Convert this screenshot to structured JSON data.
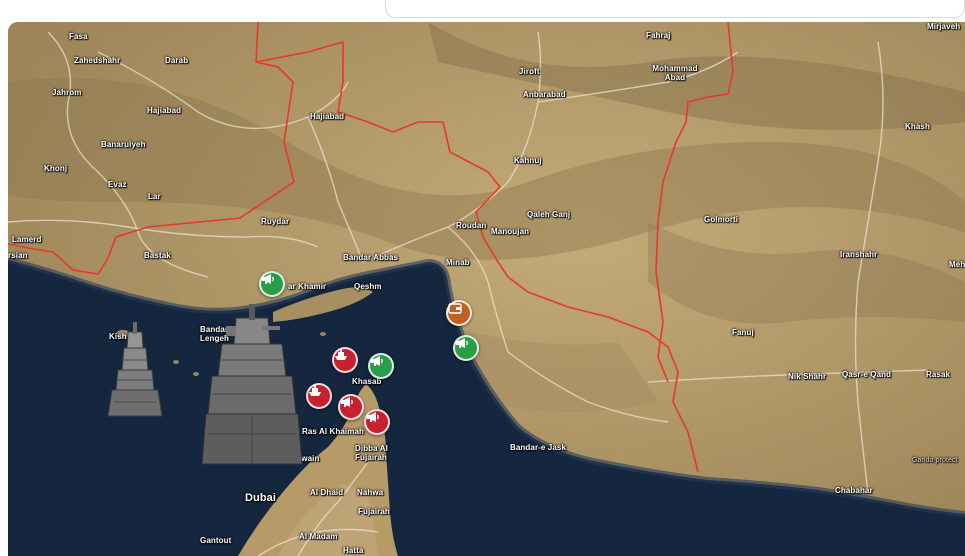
{
  "map": {
    "places": {
      "fasa": "Fasa",
      "zahedshahr": "Zahedshahr",
      "darab": "Darab",
      "jahrom": "Jahrom",
      "hajiabad_w": "Hajiabad",
      "banaruiyeh": "Banaruiyeh",
      "khonj": "Khonj",
      "evaz": "Evaz",
      "lar": "Lar",
      "lamerd": "Lamerd",
      "siran": "rsian",
      "bastak": "Bastak",
      "ruydar": "Ruydar",
      "hajiabad": "Hajiabad",
      "bandar_khamir": "ar Khamir",
      "bandar_lengeh": "Bandar-e Lengeh",
      "kish": "Kish",
      "qeshm": "Qeshm",
      "bandar_abbas": "Bandar Abbas",
      "minab": "Minab",
      "roudan": "Roudan",
      "manoujan": "Manoujan",
      "qaleh_ganj": "Qaleh Ganj",
      "kahnuj": "Kahnuj",
      "anbarabad": "Anbarabad",
      "jiroft": "Jiroft",
      "fahraj": "Fahraj",
      "mohammad_abad": "Mohammad Abad",
      "mirjaveh": "Mirjaveh",
      "khash": "Khash",
      "golmorti": "Golmorti",
      "iranshahr": "Iranshahr",
      "mehr": "Meh",
      "fanuj": "Fanuj",
      "nik_shahr": "Nik Shahr",
      "qasr_e_qand": "Qasr-e Qand",
      "rasak": "Rasak",
      "chabahar": "Chabahar",
      "bandar_e_jask": "Bandar-e Jask",
      "khasab": "Khasab",
      "ras_al_khaimah": "Ras Al Khaimah",
      "quwain": "Quwain",
      "dibba": "Dibba Al Fujairah",
      "dubai": "Dubai",
      "al_dhaid": "Al Dhaid",
      "nahwa": "Nahwa",
      "fujairah": "Fujairah",
      "gantout": "Gantout",
      "al_madam": "Al Madam",
      "hatta": "Hatta",
      "gando": "Gando protect"
    },
    "markers": [
      {
        "name": "megaphone-marker-green-khamir",
        "color": "#2a9d48",
        "icon": "megaphone-icon"
      },
      {
        "name": "ship-marker-red-1",
        "color": "#c9202f",
        "icon": "ship-icon"
      },
      {
        "name": "megaphone-marker-green-khasab",
        "color": "#2a9d48",
        "icon": "megaphone-icon"
      },
      {
        "name": "ship-marker-red-2",
        "color": "#c9202f",
        "icon": "ship-icon"
      },
      {
        "name": "megaphone-marker-red-1",
        "color": "#c9202f",
        "icon": "megaphone-icon"
      },
      {
        "name": "megaphone-marker-red-2",
        "color": "#c9202f",
        "icon": "megaphone-icon"
      },
      {
        "name": "wallet-marker-orange",
        "color": "#c0621d",
        "icon": "wallet-icon"
      },
      {
        "name": "megaphone-marker-green-coast",
        "color": "#2a9d48",
        "icon": "megaphone-icon"
      }
    ],
    "colors": {
      "sea": "#15263f",
      "land": "#b39a6a",
      "border": "#e8382a",
      "road": "#e9e2cf"
    }
  }
}
